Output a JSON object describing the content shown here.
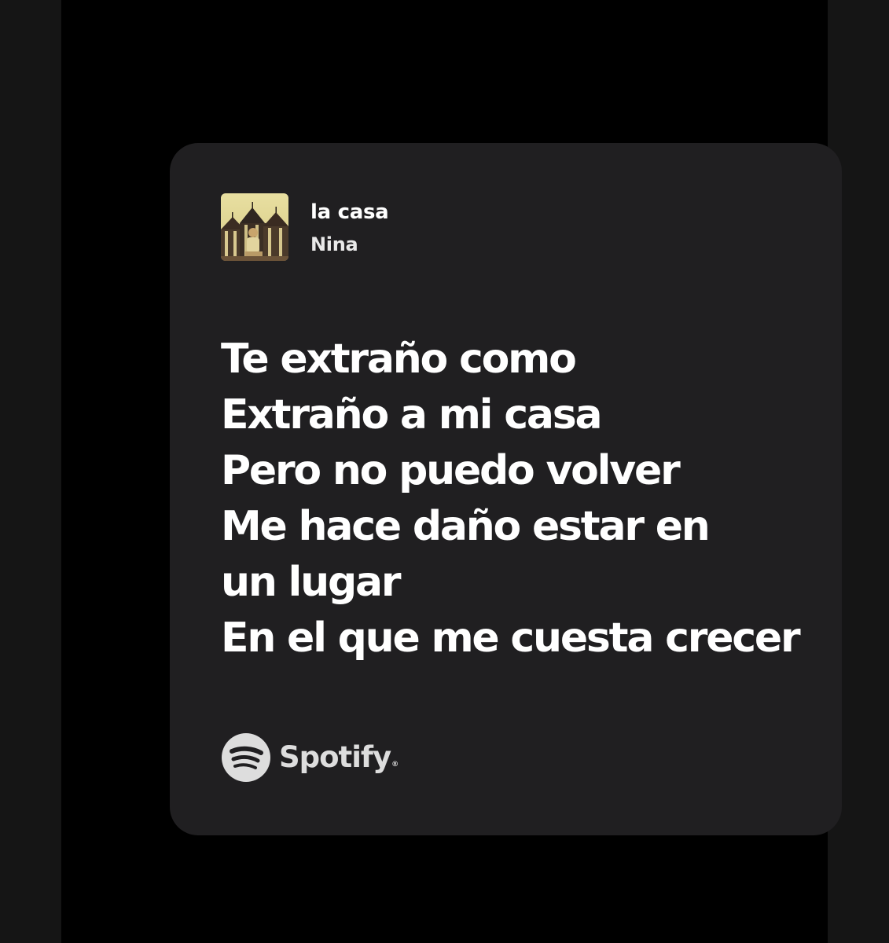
{
  "track": {
    "title": "la casa",
    "artist": "Nina",
    "cover_icon": "album-cover"
  },
  "lyrics": {
    "lines": [
      "Te extraño como",
      "Extraño a mi casa",
      "Pero no puedo volver",
      "Me hace daño estar en",
      "un lugar",
      "En el que me cuesta crecer"
    ]
  },
  "brand": {
    "name": "Spotify",
    "registered_mark": "®",
    "icon": "spotify-logo-icon"
  },
  "colors": {
    "outer_background": "#151515",
    "stage_background": "#000000",
    "card_background": "#201f21",
    "text_primary": "#ffffff",
    "brand_logo": "#dddddd"
  }
}
